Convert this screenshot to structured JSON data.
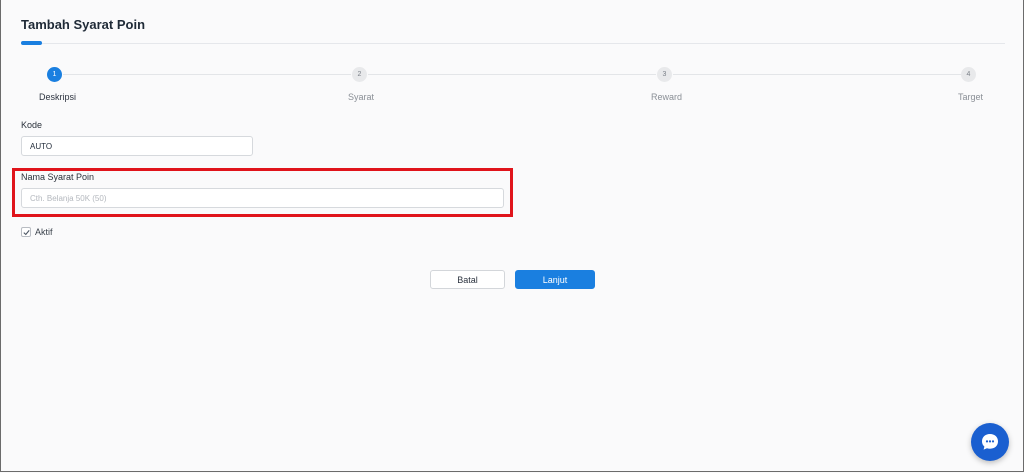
{
  "header": {
    "title": "Tambah Syarat Poin"
  },
  "stepper": {
    "steps": [
      {
        "number": "1",
        "label": "Deskripsi",
        "active": true
      },
      {
        "number": "2",
        "label": "Syarat",
        "active": false
      },
      {
        "number": "3",
        "label": "Reward",
        "active": false
      },
      {
        "number": "4",
        "label": "Target",
        "active": false
      }
    ]
  },
  "form": {
    "kode": {
      "label": "Kode",
      "value": "AUTO"
    },
    "nama": {
      "label": "Nama Syarat Poin",
      "value": "",
      "placeholder": "Cth. Belanja 50K (50)"
    },
    "aktif": {
      "label": "Aktif",
      "checked": true
    }
  },
  "actions": {
    "cancel_label": "Batal",
    "next_label": "Lanjut"
  },
  "colors": {
    "accent": "#1a7fe0",
    "highlight": "#e0141b",
    "chat_button": "#1a5fd0"
  },
  "icons": {
    "check": "check-icon",
    "chat": "chat-bubble-icon"
  }
}
